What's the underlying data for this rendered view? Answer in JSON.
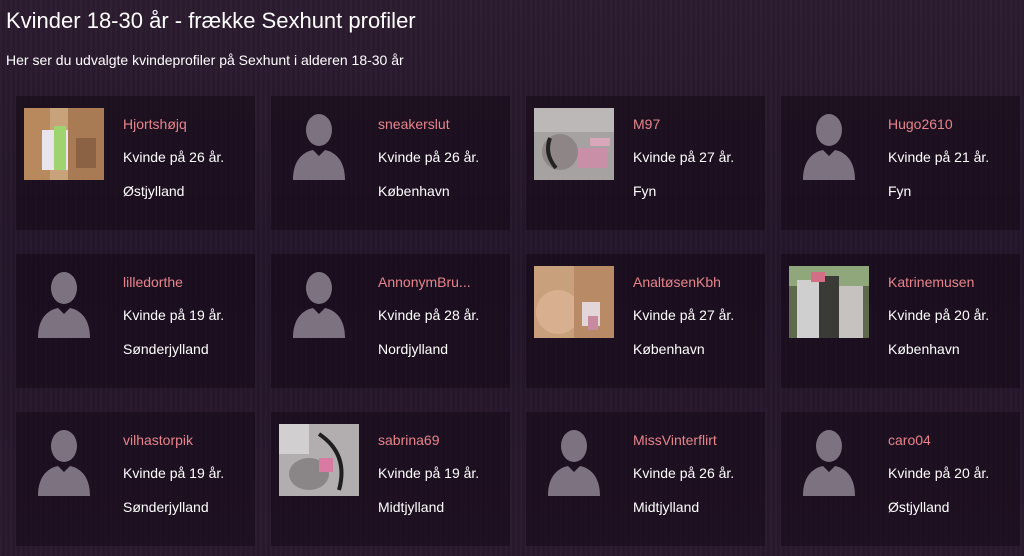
{
  "header": {
    "title": "Kvinder 18-30 år - frække Sexhunt profiler",
    "subtitle": "Her ser du udvalgte kvindeprofiler på Sexhunt i alderen 18-30 år"
  },
  "profiles": [
    {
      "name": "Hjortshøjq",
      "age": "Kvinde på 26 år.",
      "location": "Østjylland",
      "photo": "photo-1"
    },
    {
      "name": "sneakerslut",
      "age": "Kvinde på 26 år.",
      "location": "København",
      "photo": "silhouette"
    },
    {
      "name": "M97",
      "age": "Kvinde på 27 år.",
      "location": "Fyn",
      "photo": "photo-2"
    },
    {
      "name": "Hugo2610",
      "age": "Kvinde på 21 år.",
      "location": "Fyn",
      "photo": "silhouette"
    },
    {
      "name": "lilledorthe",
      "age": "Kvinde på 19 år.",
      "location": "Sønderjylland",
      "photo": "silhouette"
    },
    {
      "name": "AnnonymBru...",
      "age": "Kvinde på 28 år.",
      "location": "Nordjylland",
      "photo": "silhouette"
    },
    {
      "name": "AnaltøsenKbh",
      "age": "Kvinde på 27 år.",
      "location": "København",
      "photo": "photo-3"
    },
    {
      "name": "Katrinemusen",
      "age": "Kvinde på 20 år.",
      "location": "København",
      "photo": "photo-4"
    },
    {
      "name": "vilhastorpik",
      "age": "Kvinde på 19 år.",
      "location": "Sønderjylland",
      "photo": "silhouette"
    },
    {
      "name": "sabrina69",
      "age": "Kvinde på 19 år.",
      "location": "Midtjylland",
      "photo": "photo-5"
    },
    {
      "name": "MissVinterflirt",
      "age": "Kvinde på 26 år.",
      "location": "Midtjylland",
      "photo": "silhouette"
    },
    {
      "name": "caro04",
      "age": "Kvinde på 20 år.",
      "location": "Østjylland",
      "photo": "silhouette"
    }
  ],
  "colors": {
    "background": "#2a1a2c",
    "username": "#e7858c",
    "silhouette": "#7d7380"
  }
}
